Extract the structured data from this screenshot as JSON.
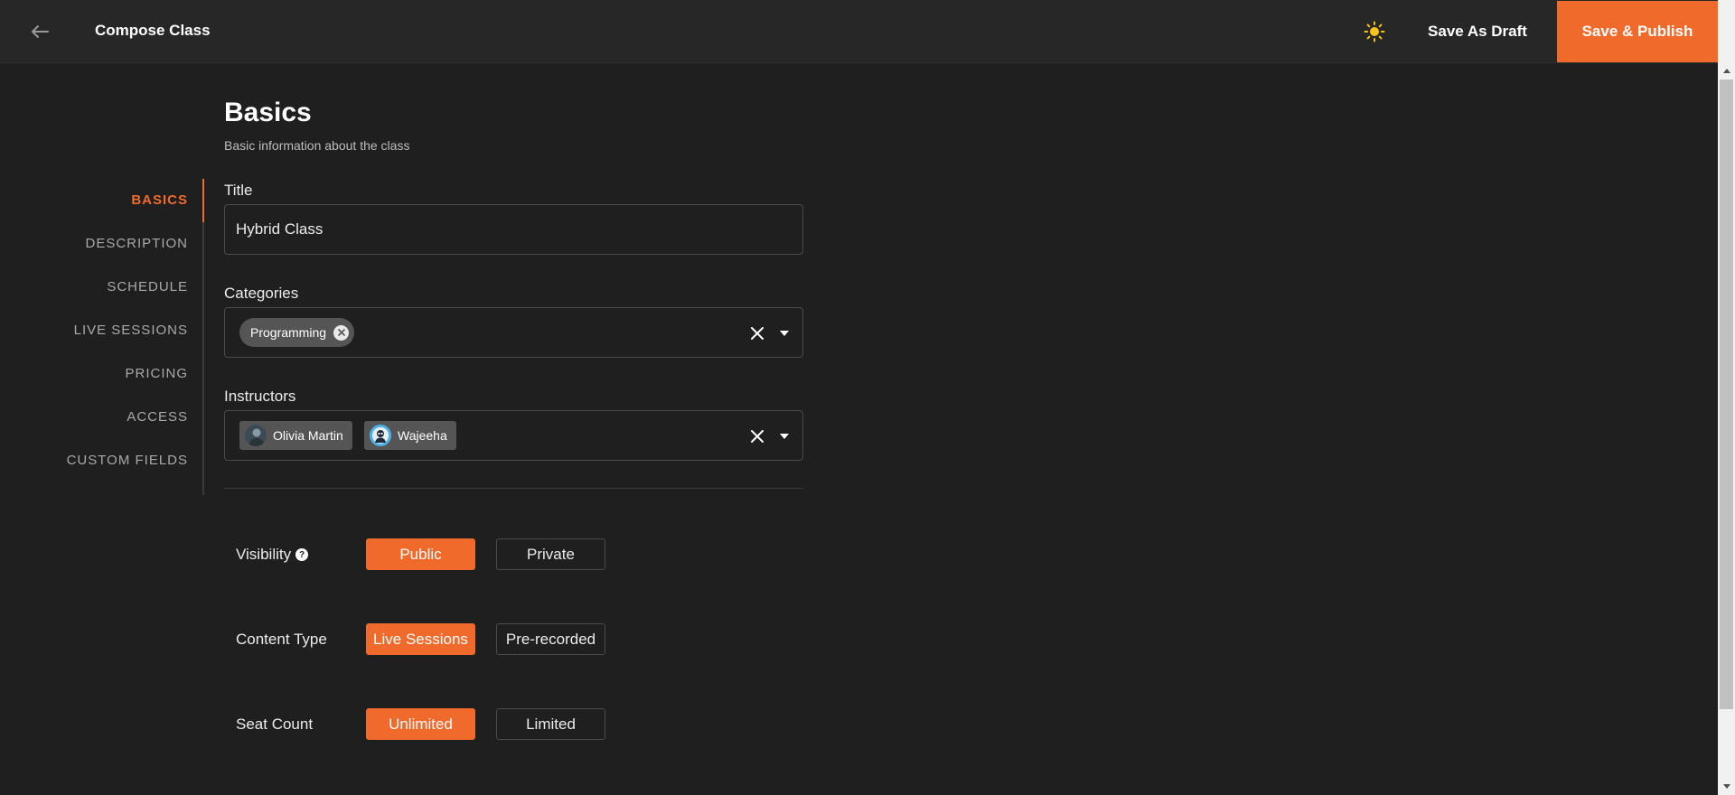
{
  "header": {
    "title": "Compose Class",
    "save_draft_label": "Save As Draft",
    "publish_label": "Save & Publish",
    "back_icon": "arrow-left-icon",
    "theme_icon": "sun-icon"
  },
  "sidebar": {
    "items": [
      {
        "label": "BASICS",
        "active": true
      },
      {
        "label": "DESCRIPTION",
        "active": false
      },
      {
        "label": "SCHEDULE",
        "active": false
      },
      {
        "label": "LIVE SESSIONS",
        "active": false
      },
      {
        "label": "PRICING",
        "active": false
      },
      {
        "label": "ACCESS",
        "active": false
      },
      {
        "label": "CUSTOM FIELDS",
        "active": false
      }
    ]
  },
  "section": {
    "title": "Basics",
    "subtitle": "Basic information about the class"
  },
  "fields": {
    "title": {
      "label": "Title",
      "value": "Hybrid Class"
    },
    "categories": {
      "label": "Categories",
      "chips": [
        "Programming"
      ]
    },
    "instructors": {
      "label": "Instructors",
      "chips": [
        "Olivia Martin",
        "Wajeeha"
      ]
    }
  },
  "options": {
    "visibility": {
      "label": "Visibility",
      "help": "?",
      "choices": [
        "Public",
        "Private"
      ],
      "selected": "Public"
    },
    "content_type": {
      "label": "Content Type",
      "choices": [
        "Live Sessions",
        "Pre-recorded"
      ],
      "selected": "Live Sessions"
    },
    "seat_count": {
      "label": "Seat Count",
      "choices": [
        "Unlimited",
        "Limited"
      ],
      "selected": "Unlimited"
    }
  },
  "colors": {
    "accent": "#f06a2c",
    "background": "#1f1f1f",
    "header": "#272727",
    "sun": "#f5c518"
  }
}
